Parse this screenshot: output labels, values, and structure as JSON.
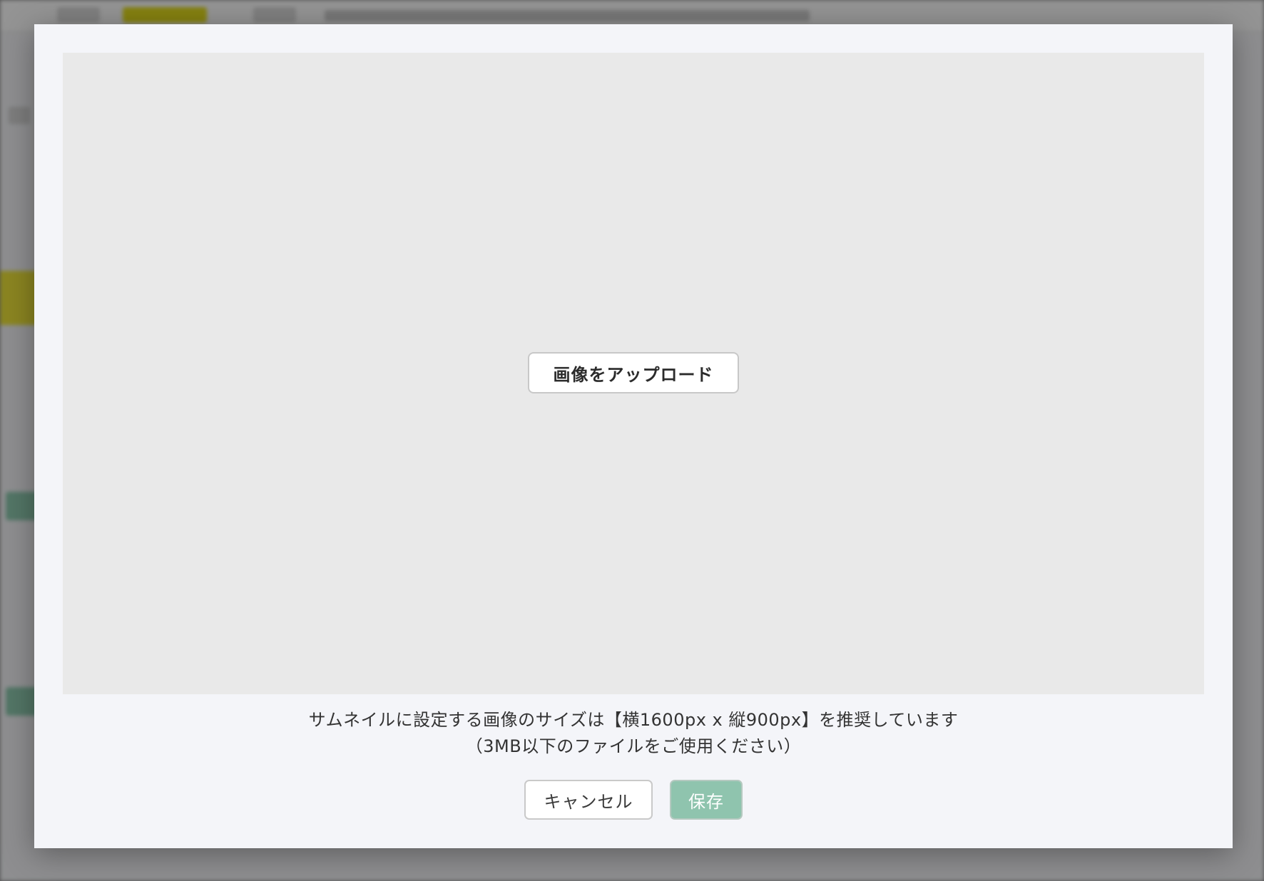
{
  "dialog": {
    "upload_label": "画像をアップロード",
    "notice_line1": "サムネイルに設定する画像のサイズは【横1600px x 縦900px】を推奨しています",
    "notice_line2": "（3MB以下のファイルをご使用ください）",
    "cancel_label": "キャンセル",
    "save_label": "保存"
  },
  "colors": {
    "save_button": "#8fc4ae",
    "modal_background": "#f4f5f9",
    "dropzone_background": "#e9e9e9"
  }
}
